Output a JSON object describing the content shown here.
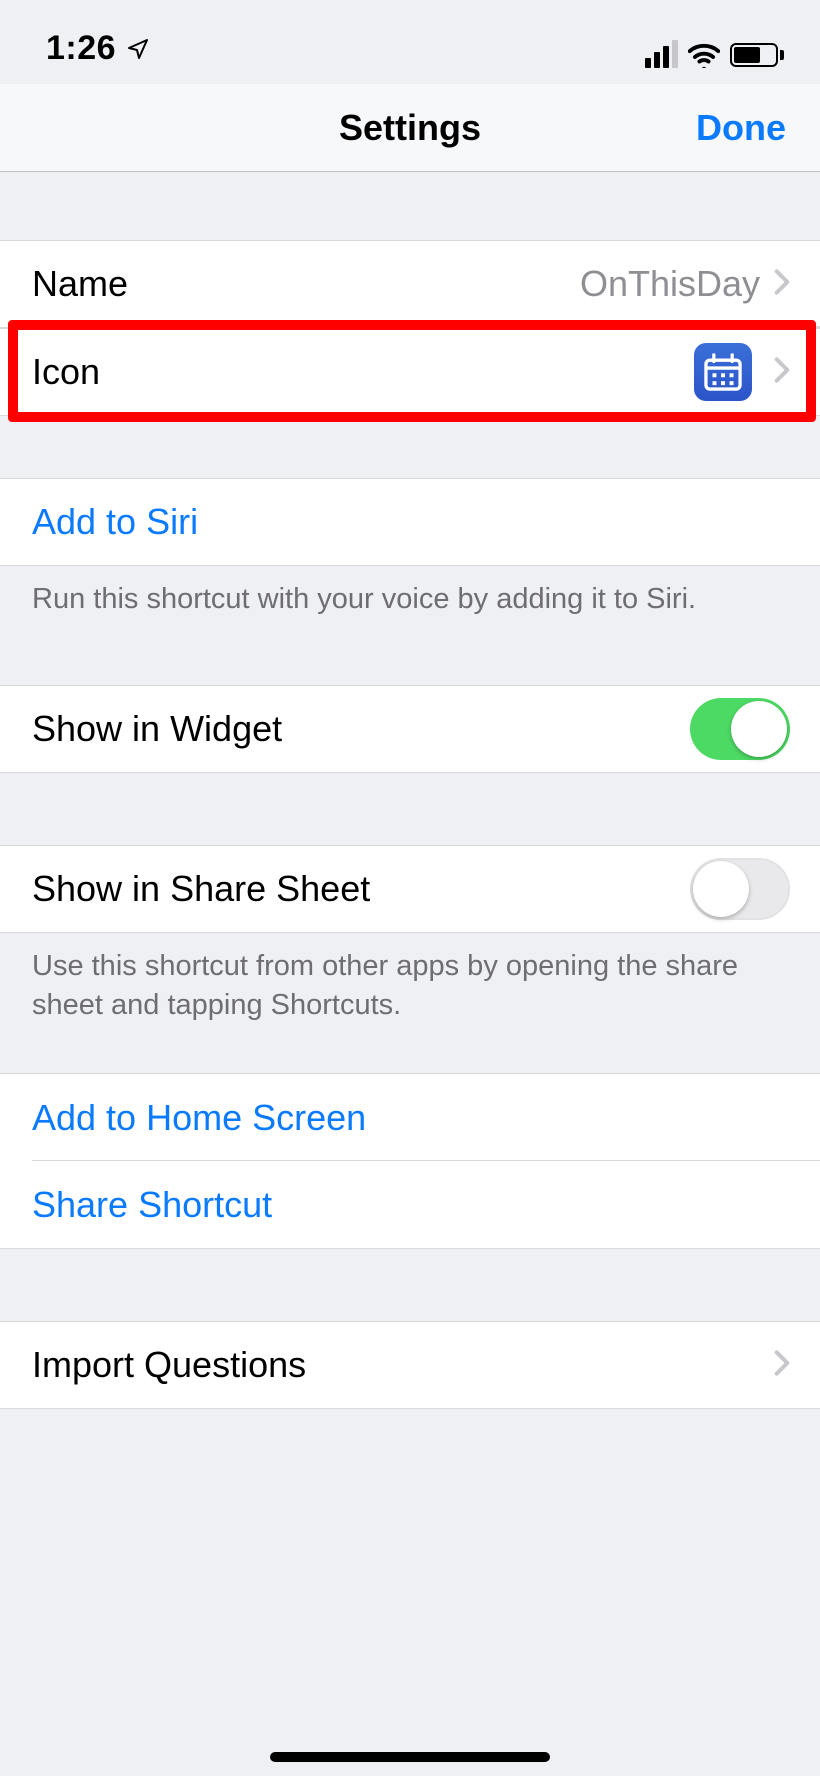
{
  "statusbar": {
    "time": "1:26"
  },
  "header": {
    "title": "Settings",
    "done": "Done"
  },
  "rows": {
    "name": {
      "label": "Name",
      "value": "OnThisDay"
    },
    "icon": {
      "label": "Icon"
    },
    "addSiri": {
      "label": "Add to Siri"
    },
    "siriFooter": "Run this shortcut with your voice by adding it to Siri.",
    "showWidget": {
      "label": "Show in Widget",
      "on": true
    },
    "showShare": {
      "label": "Show in Share Sheet",
      "on": false
    },
    "shareFooter": "Use this shortcut from other apps by opening the share sheet and tapping Shortcuts.",
    "addHome": {
      "label": "Add to Home Screen"
    },
    "shareShortcut": {
      "label": "Share Shortcut"
    },
    "importQ": {
      "label": "Import Questions"
    }
  }
}
